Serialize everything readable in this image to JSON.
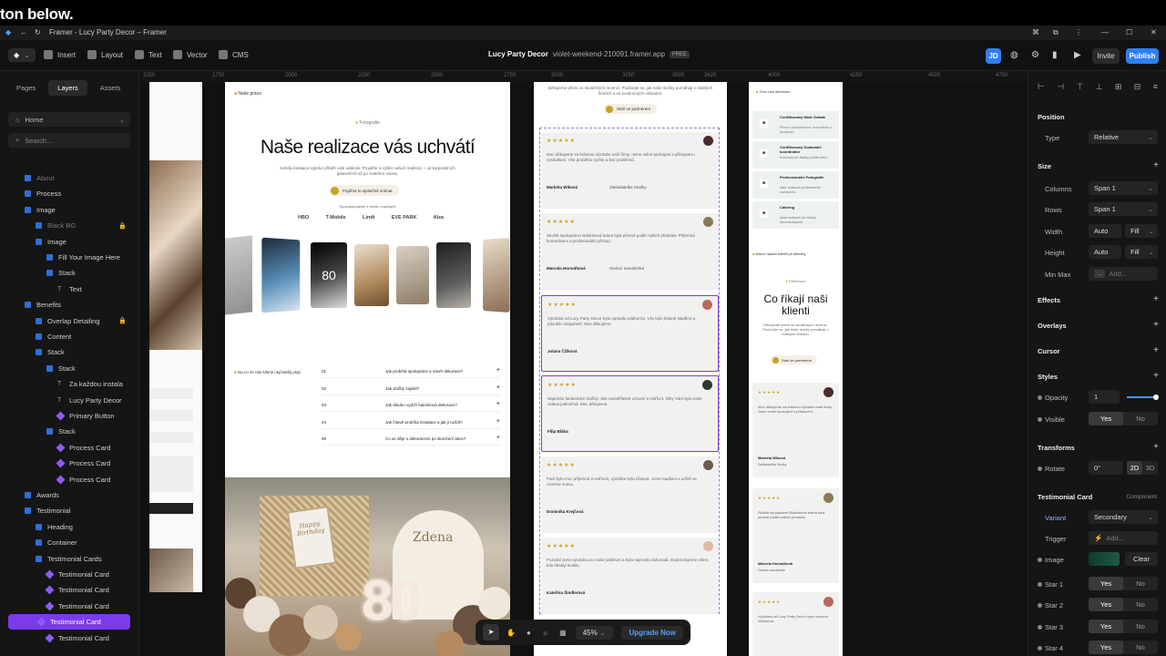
{
  "caption": "ton below.",
  "browser": {
    "title": "Framer - Lucy Party Decor – Framer"
  },
  "toolbar": {
    "insert": "Insert",
    "layout": "Layout",
    "text": "Text",
    "vector": "Vector",
    "cms": "CMS",
    "project": "Lucy Party Decor",
    "domain": "violet-weekend-210091.framer.app",
    "plan_badge": "FREE",
    "avatar": "JD",
    "invite": "Invite",
    "publish": "Publish",
    "accent": "#2f7ff0"
  },
  "leftpanel": {
    "tabs": [
      "Pages",
      "Layers",
      "Assets"
    ],
    "page_select": "Home",
    "search_placeholder": "Search...",
    "layers": [
      {
        "label": "About",
        "kind": "sq"
      },
      {
        "label": "Process",
        "kind": "sq"
      },
      {
        "label": "Image",
        "kind": "sq"
      },
      {
        "label": "Black BG",
        "kind": "sq",
        "locked": true
      },
      {
        "label": "Image",
        "kind": "sq"
      },
      {
        "label": "Fill Your Image Here",
        "kind": "sq"
      },
      {
        "label": "Stack",
        "kind": "sq"
      },
      {
        "label": "Text",
        "kind": "tx"
      },
      {
        "label": "Benefits",
        "kind": "sq"
      },
      {
        "label": "Overlap Detailing",
        "kind": "sq",
        "locked": true
      },
      {
        "label": "Content",
        "kind": "sq"
      },
      {
        "label": "Stack",
        "kind": "sq"
      },
      {
        "label": "Stack",
        "kind": "sq"
      },
      {
        "label": "Za každou instala",
        "kind": "tx"
      },
      {
        "label": "Lucy Party Decor",
        "kind": "tx"
      },
      {
        "label": "Primary Button",
        "kind": "dm"
      },
      {
        "label": "Stack",
        "kind": "sq"
      },
      {
        "label": "Process Card",
        "kind": "dm"
      },
      {
        "label": "Process Card",
        "kind": "dm"
      },
      {
        "label": "Process Card",
        "kind": "dm"
      },
      {
        "label": "Awards",
        "kind": "sq"
      },
      {
        "label": "Testimonial",
        "kind": "sq"
      },
      {
        "label": "Heading",
        "kind": "sq"
      },
      {
        "label": "Container",
        "kind": "sq"
      },
      {
        "label": "Testimonial Cards",
        "kind": "sq"
      },
      {
        "label": "Testimonial Card",
        "kind": "dm"
      },
      {
        "label": "Testimonial Card",
        "kind": "dm"
      },
      {
        "label": "Testimonial Card",
        "kind": "dm"
      },
      {
        "label": "Testimonial Card",
        "kind": "dm",
        "selected": true
      },
      {
        "label": "Testimonial Card",
        "kind": "dm"
      }
    ]
  },
  "canvas": {
    "ruler": [
      "2250",
      "1750",
      "2000",
      "2250",
      "2500",
      "2750",
      "3000",
      "3250",
      "3500",
      "3620",
      "4000",
      "4250",
      "4500",
      "4750"
    ],
    "realizace": {
      "section_label": "Naše práce",
      "eyebrow": "Fotografie",
      "title": "Naše realizace vás uchvátí",
      "subtitle": "Každá instalace vypráví příběh vaší události. Projděte si výběr našich realizací – od korporátních galavečerů až po svatební oslavy.",
      "cta": "Pojďme to společně vnímat",
      "partners_label": "Spolupracujeme s těmito značkami",
      "partners": [
        "HBO",
        "T-Mobile",
        "Lindt",
        "EVE PARK",
        "Alza"
      ]
    },
    "faq": {
      "label": "Na co se nás klienti nejčastěji ptají",
      "items": [
        {
          "num": "01",
          "q": "Jak probíhá spolupráce a návrh dekorace?"
        },
        {
          "num": "02",
          "q": "Jak služby zajistit?"
        },
        {
          "num": "03",
          "q": "Jak dlouho vydrží balónková dekorace?"
        },
        {
          "num": "04",
          "q": "Jak čítavě probíhá instalace a jak ji rozbít?"
        },
        {
          "num": "05",
          "q": "Co se děje s dekoracemi po skončení akce?"
        }
      ]
    },
    "hero2": {
      "sign": "Happy Birthday",
      "name": "Zdena",
      "number": "80"
    },
    "testimonials": {
      "intro": "Děkujeme přízni za skutečných recenzí. Podívejte se, jak naše služby pomáhají v reálných firmách a na soukromých oslavách.",
      "cta": "Staň se partnerem",
      "cards": [
        {
          "text": "Moc děkujeme za krásnou výzdobu naší firmy. Jsme velmi spokojeni s přístupem i výsledkem. Vše proběhlo rychle a bez problémů.",
          "author": "Markéta Wiková",
          "role": "Zakladatelka Studky"
        },
        {
          "text": "Skvělá spolupráce! Balónková brána byla přesně podle našich představ. Příjemná komunikace a profesionální přístup.",
          "author": "Marcela Horvathová",
          "role": "Osobní manažerka"
        },
        {
          "text": "Výzdoba od Lucy Party Decor byla opravdu nádherná. Vše bylo krásně sladěné a působilo elegantně. Moc děkujeme.",
          "author": "Jolana Čížková",
          "role": ""
        },
        {
          "text": "Naprosto fantastické služby! Jste neuvěřitelně ochotní a vstřícní. Díky Vám byla naše oslava jedinečná. Moc děkujeme.",
          "author": "Filip Bláha",
          "role": ""
        },
        {
          "text": "Paní byla moc příjemná a vstřícná, výzdoba byla úžasná. Jsme nadšeni a určitě se ozveme znovu.",
          "author": "Dominika Krejčová",
          "role": ""
        },
        {
          "text": "Pozvání jsme výzdobu pro naše jubileum a byla naprosto dokonalá. Doporučujeme všem, kdo hledají kvalitu.",
          "author": "Kateřina Šindlerová",
          "role": ""
        }
      ]
    },
    "mobile": {
      "label": "Chci více informací",
      "services": [
        {
          "title": "Certifikovaný Mistr Svitáte",
          "desc": "Přímá s představením, komunikací a kompozicí."
        },
        {
          "title": "Certifikovaný Dodavatel koordinátor",
          "desc": "Dokonalý pro hladký průběh akce."
        },
        {
          "title": "Professionální Fotografie",
          "desc": "Vaše realizace profesionálně zachycená."
        },
        {
          "title": "Catering",
          "desc": "Naše realizace pro klienty dokumentujeme."
        }
      ],
      "testimonial_label": "Názor našich klientů je důležitý",
      "eyebrow": "Reference",
      "title": "Co říkají naši klienti",
      "subtitle": "Děkujeme přízni za skutečných recenzí. Podívejte se, jak naše služby pomáhají v reálných firmách.",
      "cta": "Staň se partnerem",
      "cards": [
        {
          "text": "Moc děkujeme za krásnou výzdobu naší firmy. Jsme velmi spokojeni s přístupem.",
          "author": "Markéta Wiková",
          "role": "Zakladatelka Studky"
        },
        {
          "text": "Skvělá spolupráce! Balónková brána byla přesně podle našich představ.",
          "author": "Marcela Horvathová",
          "role": "Osobní manažerka"
        },
        {
          "text": "Výzdoba od Lucy Party Decor byla opravdu nádherná.",
          "author": "",
          "role": ""
        }
      ]
    }
  },
  "rightpanel": {
    "position": {
      "title": "Position",
      "type_label": "Type",
      "type_value": "Relative"
    },
    "size": {
      "title": "Size",
      "rows": [
        {
          "label": "Columns",
          "value": "Span 1"
        },
        {
          "label": "Rows",
          "value": "Span 1"
        },
        {
          "label": "Width",
          "value": "Auto",
          "mode": "Fill"
        },
        {
          "label": "Height",
          "value": "Auto",
          "mode": "Fill"
        },
        {
          "label": "Min Max",
          "value": "Add..."
        }
      ]
    },
    "sections": [
      "Effects",
      "Overlays",
      "Cursor",
      "Styles"
    ],
    "opacity": {
      "label": "Opacity",
      "value": "1"
    },
    "visible": {
      "label": "Visible",
      "yes": "Yes",
      "no": "No"
    },
    "transforms": {
      "title": "Transforms",
      "rotate_label": "Rotate",
      "rotate_value": "0°",
      "mode_2d": "2D",
      "mode_3d": "3D"
    },
    "component": {
      "title": "Testimonial Card",
      "kind": "Component",
      "variant_label": "Variant",
      "variant_value": "Secondary",
      "trigger_label": "Trigger",
      "trigger_value": "Add...",
      "image_label": "Image",
      "clear": "Clear",
      "stars": [
        {
          "label": "Star 1",
          "yes": "Yes",
          "no": "No"
        },
        {
          "label": "Star 2",
          "yes": "Yes",
          "no": "No"
        },
        {
          "label": "Star 3",
          "yes": "Yes",
          "no": "No"
        },
        {
          "label": "Star 4",
          "yes": "Yes",
          "no": "No"
        }
      ]
    }
  },
  "bottombar": {
    "zoom": "45%",
    "upgrade": "Upgrade Now"
  }
}
